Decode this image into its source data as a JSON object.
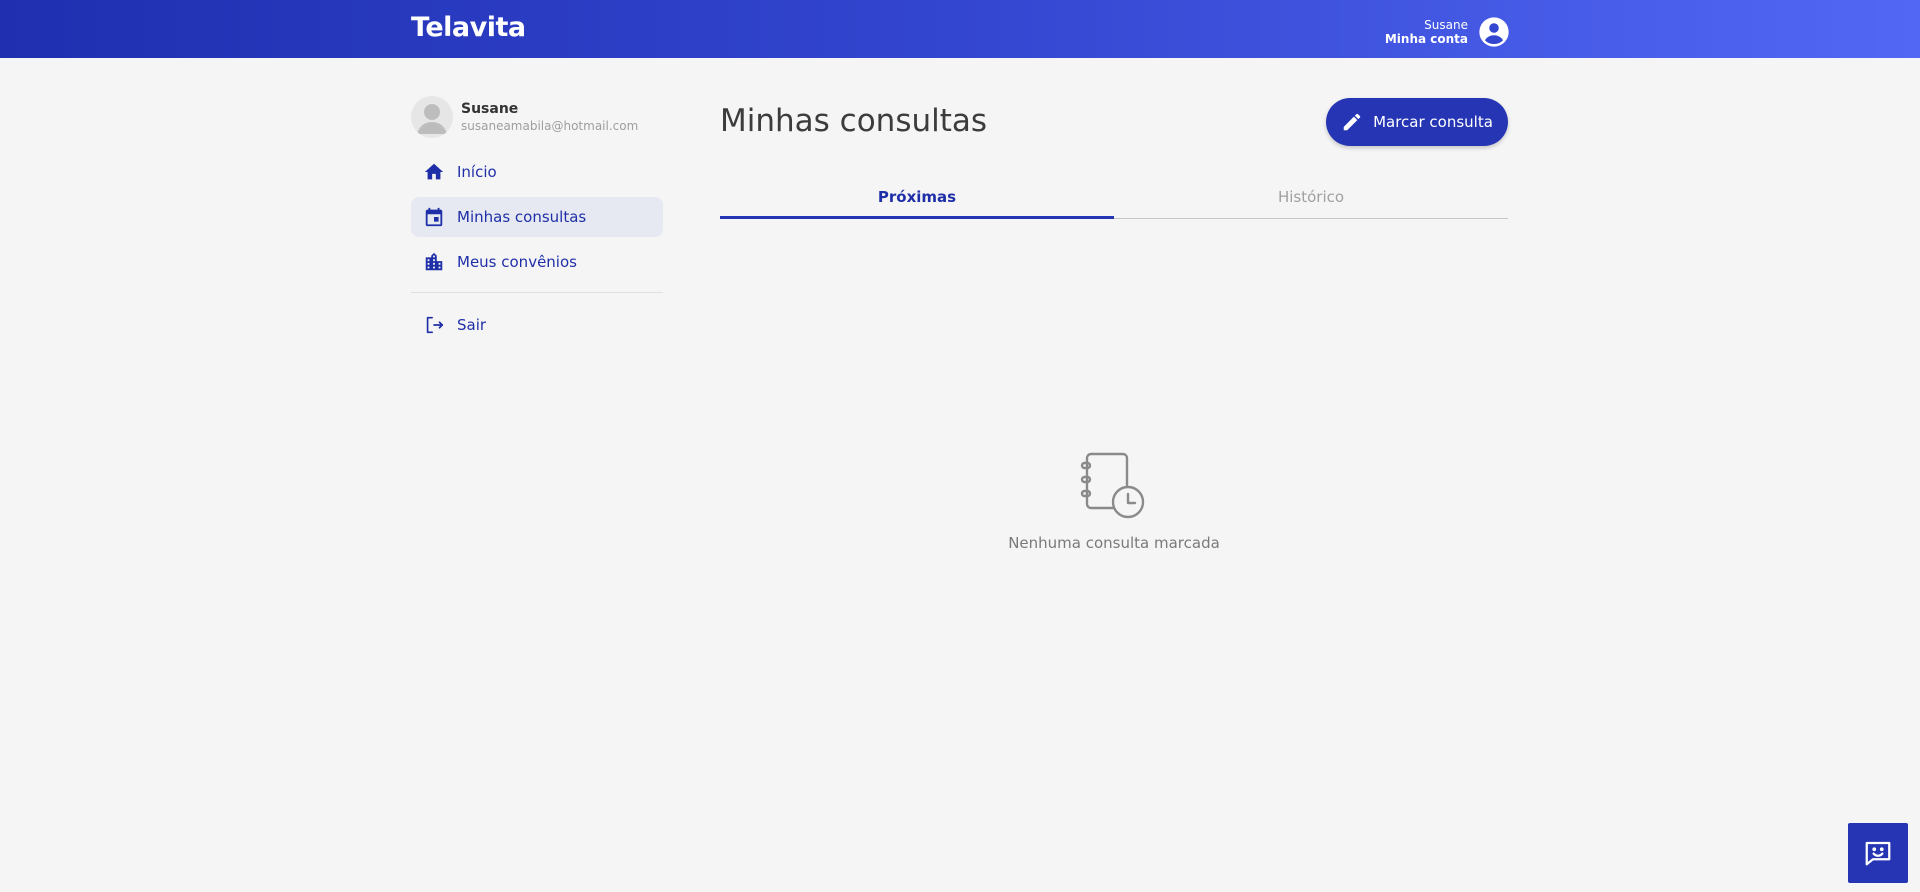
{
  "header": {
    "logo": "Telavita",
    "user_name": "Susane",
    "account_label": "Minha conta"
  },
  "sidebar": {
    "profile": {
      "name": "Susane",
      "email": "susaneamabila@hotmail.com"
    },
    "items": [
      {
        "label": "Início",
        "icon": "home-icon"
      },
      {
        "label": "Minhas consultas",
        "icon": "calendar-icon",
        "active": true
      },
      {
        "label": "Meus convênios",
        "icon": "building-icon"
      }
    ],
    "logout_label": "Sair"
  },
  "main": {
    "title": "Minhas consultas",
    "cta_label": "Marcar consulta",
    "tabs": [
      {
        "label": "Próximas",
        "active": true
      },
      {
        "label": "Histórico",
        "active": false
      }
    ],
    "empty_message": "Nenhuma consulta marcada"
  },
  "colors": {
    "primary": "#2535b3",
    "header_gradient_start": "#1f2fb0",
    "header_gradient_end": "#5268f5",
    "background": "#f5f5f5"
  }
}
